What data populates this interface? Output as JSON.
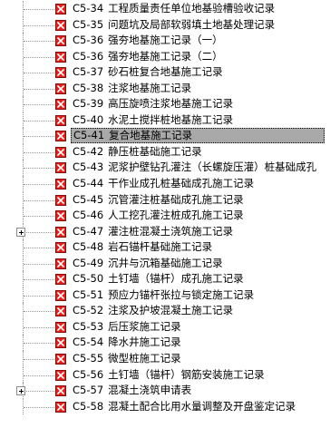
{
  "tree": {
    "items": [
      {
        "code": "C5-34",
        "title": "工程质量责任单位地基验槽验收记录",
        "expandable": false,
        "selected": false
      },
      {
        "code": "C5-35",
        "title": "问题坑及局部软弱填土地基处理记录",
        "expandable": false,
        "selected": false
      },
      {
        "code": "C5-36",
        "title": "强夯地基施工记录（一）",
        "expandable": false,
        "selected": false
      },
      {
        "code": "C5-36",
        "title": "强夯地基施工记录（二）",
        "expandable": false,
        "selected": false
      },
      {
        "code": "C5-37",
        "title": "砂石桩复合地基施工记录",
        "expandable": false,
        "selected": false
      },
      {
        "code": "C5-38",
        "title": "注浆地基施工记录",
        "expandable": false,
        "selected": false
      },
      {
        "code": "C5-39",
        "title": "高压旋喷注浆地基施工记录",
        "expandable": false,
        "selected": false
      },
      {
        "code": "C5-40",
        "title": "水泥土搅拌桩地基施工记录",
        "expandable": false,
        "selected": false
      },
      {
        "code": "C5-41",
        "title": "复合地基施工记录",
        "expandable": false,
        "selected": true
      },
      {
        "code": "C5-42",
        "title": "静压桩基础施工记录",
        "expandable": false,
        "selected": false
      },
      {
        "code": "C5-43",
        "title": "泥浆护壁钻孔灌注（长螺旋压灌）桩基础成孔",
        "expandable": false,
        "selected": false
      },
      {
        "code": "C5-44",
        "title": "干作业成孔桩基础成孔施工记录",
        "expandable": false,
        "selected": false
      },
      {
        "code": "C5-45",
        "title": "沉管灌注桩基础成孔施工记录",
        "expandable": false,
        "selected": false
      },
      {
        "code": "C5-46",
        "title": "人工挖孔灌注桩成孔施工记录",
        "expandable": false,
        "selected": false
      },
      {
        "code": "C5-47",
        "title": "灌注桩混凝土浇筑施工记录",
        "expandable": true,
        "selected": false
      },
      {
        "code": "C5-48",
        "title": "岩石锚杆基础施工记录",
        "expandable": false,
        "selected": false
      },
      {
        "code": "C5-49",
        "title": "沉井与沉箱基础施工记录",
        "expandable": false,
        "selected": false
      },
      {
        "code": "C5-50",
        "title": "土钉墙（锚杆）成孔施工记录",
        "expandable": false,
        "selected": false
      },
      {
        "code": "C5-51",
        "title": "预应力锚杆张拉与锁定施工记录",
        "expandable": false,
        "selected": false
      },
      {
        "code": "C5-52",
        "title": "注浆及护坡混凝土施工记录",
        "expandable": false,
        "selected": false
      },
      {
        "code": "C5-53",
        "title": "后压浆施工记录",
        "expandable": false,
        "selected": false
      },
      {
        "code": "C5-54",
        "title": "降水井施工记录",
        "expandable": false,
        "selected": false
      },
      {
        "code": "C5-55",
        "title": "微型桩施工记录",
        "expandable": false,
        "selected": false
      },
      {
        "code": "C5-56",
        "title": "土钉墙（锚杆）钢筋安装施工记录",
        "expandable": false,
        "selected": false
      },
      {
        "code": "C5-57",
        "title": "混凝土浇筑申请表",
        "expandable": true,
        "selected": false
      },
      {
        "code": "C5-58",
        "title": "混凝土配合比用水量调整及开盘鉴定记录",
        "expandable": false,
        "selected": false
      }
    ]
  },
  "icons": {
    "item_icon": "red-x-form-icon",
    "expander_icon": "plus-box-icon"
  },
  "colors": {
    "icon_red": "#e0221e",
    "selection_bg": "#a9a9a9"
  }
}
